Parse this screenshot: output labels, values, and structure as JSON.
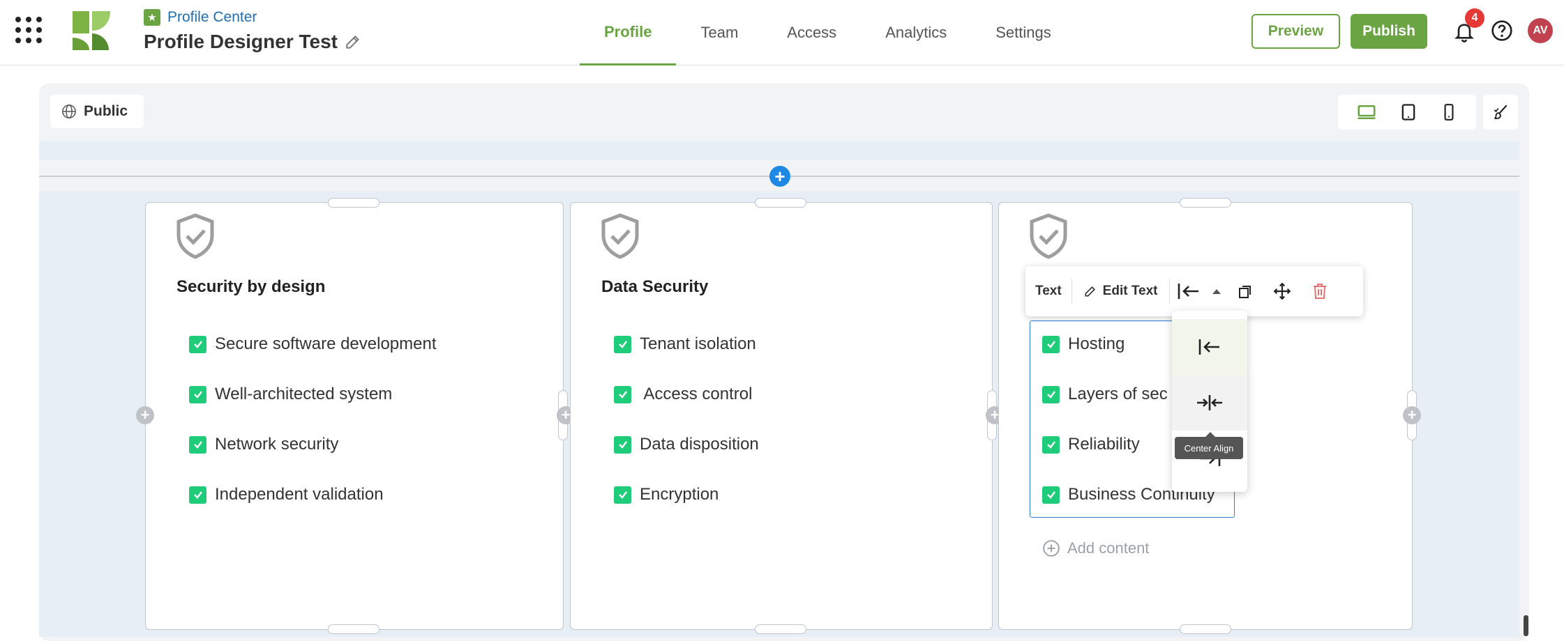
{
  "header": {
    "breadcrumb": "Profile Center",
    "title": "Profile Designer Test",
    "tabs": [
      {
        "label": "Profile",
        "active": true
      },
      {
        "label": "Team",
        "active": false
      },
      {
        "label": "Access",
        "active": false
      },
      {
        "label": "Analytics",
        "active": false
      },
      {
        "label": "Settings",
        "active": false
      }
    ],
    "preview_label": "Preview",
    "publish_label": "Publish",
    "notification_count": "4",
    "avatar_initials": "AV"
  },
  "canvas": {
    "visibility_label": "Public",
    "active_device": "desktop",
    "accent_color": "#6aa443",
    "add_content_label": "Add content"
  },
  "cards": [
    {
      "title": "Security by design",
      "items": [
        "Secure software development",
        "Well-architected system",
        "Network security",
        "Independent validation"
      ]
    },
    {
      "title": "Data Security",
      "items": [
        "Tenant isolation",
        " Access control",
        "Data disposition",
        "Encryption"
      ]
    },
    {
      "title": "",
      "items": [
        "Hosting",
        "Layers of sec",
        "Reliability",
        "Business Continuity"
      ]
    }
  ],
  "toolbar": {
    "type_label": "Text",
    "edit_label": "Edit Text",
    "tooltip": "Center Align"
  }
}
